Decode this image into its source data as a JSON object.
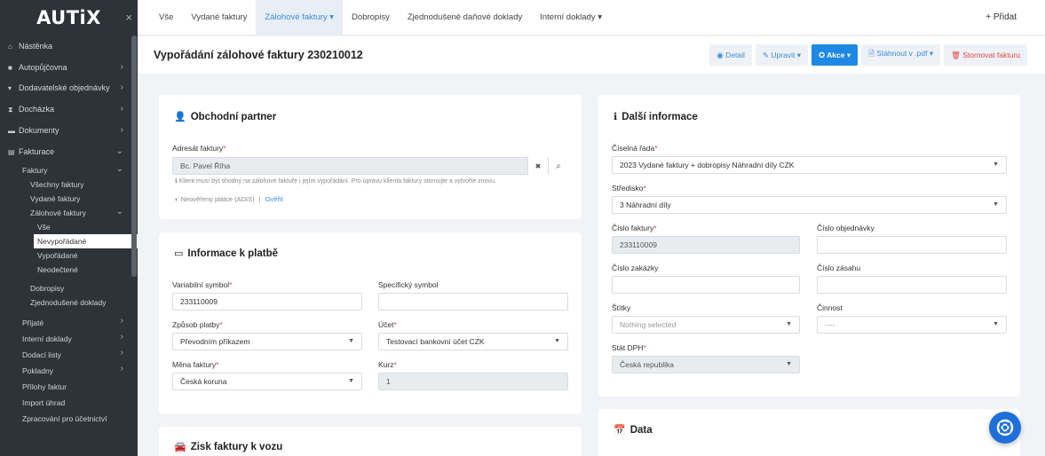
{
  "sidebar": {
    "logo": "AUTiX",
    "close": "×",
    "items": [
      {
        "icon": "⌂",
        "label": "Nástěnka"
      },
      {
        "icon": "■",
        "label": "Autopůjčovna"
      },
      {
        "icon": "▾",
        "label": "Dodavatelské objednávky"
      },
      {
        "icon": "⧗",
        "label": "Docházka"
      },
      {
        "icon": "▬",
        "label": "Dokumenty"
      },
      {
        "icon": "▤",
        "label": "Fakturace"
      }
    ],
    "fakturace": {
      "faktury": "Faktury",
      "vsechny": "Všechny faktury",
      "vydane": "Vydané faktury",
      "zalohove": "Zálohové faktury",
      "vse": "Vše",
      "nevyporadane": "Nevypořádané",
      "vyporadane": "Vypořádané",
      "neodectene": "Neodečtené",
      "dobropisy": "Dobropisy",
      "zjednodusene": "Zjednodušené doklady"
    },
    "lower": [
      {
        "label": "Přijaté",
        "chev": true
      },
      {
        "label": "Interní doklady",
        "chev": true
      },
      {
        "label": "Dodací listy",
        "chev": true
      },
      {
        "label": "Pokladny",
        "chev": true
      },
      {
        "label": "Přílohy faktur",
        "chev": false
      },
      {
        "label": "Import úhrad",
        "chev": false
      },
      {
        "label": "Zpracování pro účetnictví",
        "chev": false
      }
    ]
  },
  "topnav": {
    "tabs": [
      "Vše",
      "Vydané faktury",
      "Zálohové faktury ▾",
      "Dobropisy",
      "Zjednodušené daňové doklady",
      "Interní doklady ▾"
    ],
    "add": "+ Přidat"
  },
  "titlebar": {
    "title": "Vypořádání zálohové faktury 230210012",
    "detail": "◉ Detail",
    "upravit": "✎ Upravit ▾",
    "akce": "✪ Akce ▾",
    "stahnout": "🗎 Stáhnout v .pdf ▾",
    "stornovat": "🗑 Stornovat fakturu"
  },
  "partner": {
    "title": "Obchodní partner",
    "icon": "👤",
    "adresat_label": "Adresát faktury",
    "adresat_value": "Bc. Pavel Říha",
    "clear": "✖",
    "search": "⌕",
    "hint": "ℹ  Klient musí být shodný na zálohové faktuře i jejím vypořádání. Pro úpravu klienta faktury stornujte a vytvořte znovu.",
    "adis": "◐ Neověřený plátce (ADIS)",
    "sep": "|",
    "overit": "Ověřit"
  },
  "platba": {
    "title": "Informace k platbě",
    "icon": "▭",
    "vs_label": "Variabilní symbol",
    "vs_value": "233110009",
    "ss_label": "Specifický symbol",
    "ss_value": "",
    "zp_label": "Způsob platby",
    "zp_value": "Převodním příkazem",
    "ucet_label": "Účet",
    "ucet_value": "Testovací bankovní účet CZK",
    "mena_label": "Měna faktury",
    "mena_value": "Česká koruna",
    "kurz_label": "Kurz",
    "kurz_value": "1"
  },
  "zisk": {
    "title": "Zisk faktury k vozu",
    "icon": "🚘"
  },
  "dalsi": {
    "title": "Další informace",
    "icon": "ℹ",
    "rada_label": "Číselná řada",
    "rada_value": "2023 Vydané faktury + dobropisy Náhradní díly CZK",
    "stredisko_label": "Středisko",
    "stredisko_value": "3 Náhradní díly",
    "cislo_label": "Číslo faktury",
    "cislo_value": "233110009",
    "objednavka_label": "Číslo objednávky",
    "zakazka_label": "Číslo zakázky",
    "zasah_label": "Číslo zásahu",
    "stitky_label": "Štítky",
    "stitky_value": "Nothing selected",
    "cinnost_label": "Činnost",
    "cinnost_value": "----",
    "stat_label": "Stát DPH",
    "stat_value": "Česká republika"
  },
  "data_card": {
    "title": "Data",
    "icon": "📅"
  }
}
